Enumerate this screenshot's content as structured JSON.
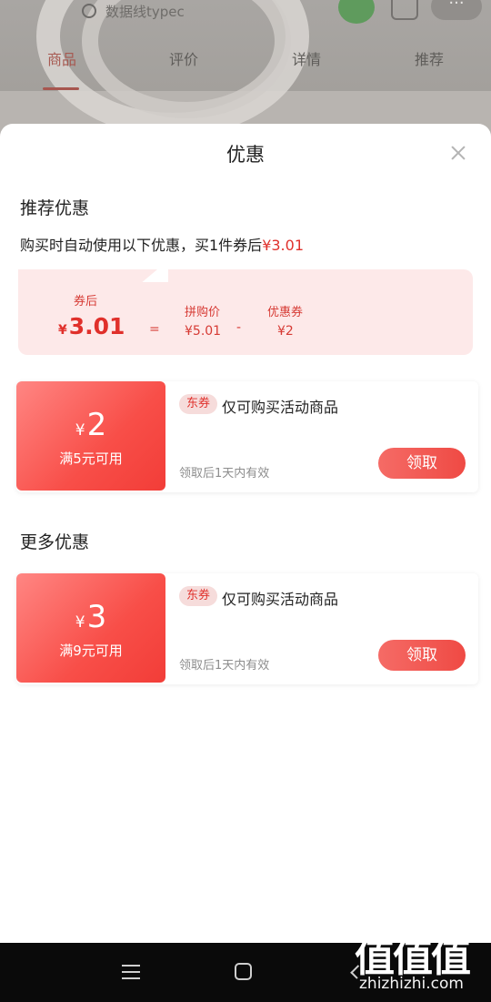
{
  "background": {
    "search_placeholder": "数据线typec",
    "tabs": [
      "商品",
      "评价",
      "详情",
      "推荐"
    ],
    "more_label": "···"
  },
  "sheet": {
    "title": "优惠",
    "recommend_title": "推荐优惠",
    "desc_prefix": "购买时自动使用以下优惠，买1件券后",
    "desc_price": "¥3.01",
    "calc": {
      "after_label": "券后",
      "after_yen": "¥",
      "after_value": "3.01",
      "equals": "=",
      "group_label": "拼购价",
      "group_value": "¥5.01",
      "minus": "-",
      "coupon_label": "优惠券",
      "coupon_value": "¥2"
    },
    "more_title": "更多优惠",
    "coupons": [
      {
        "yen": "¥",
        "amount": "2",
        "condition": "满5元可用",
        "badge": "东券",
        "description": "仅可购买活动商品",
        "validity": "领取后1天内有效",
        "button": "领取"
      },
      {
        "yen": "¥",
        "amount": "3",
        "condition": "满9元可用",
        "badge": "东券",
        "description": "仅可购买活动商品",
        "validity": "领取后1天内有效",
        "button": "领取"
      }
    ]
  },
  "watermark": {
    "logo": "值值值",
    "url": "zhizhizhi.com"
  },
  "colors": {
    "accent": "#e0302b",
    "calc_bg": "#fde9e9",
    "badge_bg": "#f6dcdb"
  }
}
